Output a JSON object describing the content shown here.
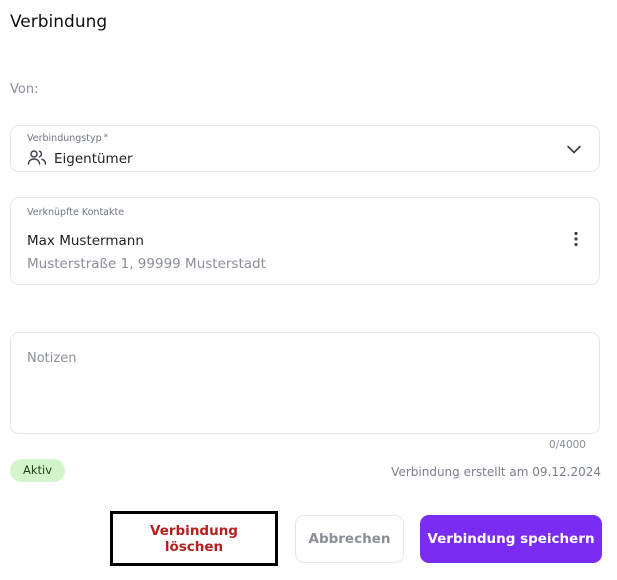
{
  "dialog": {
    "title": "Verbindung",
    "from_label": "Von:"
  },
  "connection_type": {
    "label": "Verbindungstyp",
    "required_mark": "*",
    "value": "Eigentümer",
    "icon": "people-icon",
    "dropdown_icon": "chevron-down-icon"
  },
  "linked_contacts": {
    "label": "Verknüpfte Kontakte",
    "contact": {
      "name": "Max Mustermann",
      "address": "Musterstraße 1, 99999 Musterstadt"
    },
    "menu_icon": "more-vertical-icon"
  },
  "notes": {
    "placeholder": "Notizen",
    "value": "",
    "counter": "0/4000"
  },
  "status": {
    "badge": "Aktiv",
    "badge_color": "#d3f5cc",
    "created_text": "Verbindung erstellt am 09.12.2024"
  },
  "actions": {
    "delete_label": "Verbindung löschen",
    "cancel_label": "Abbrechen",
    "save_label": "Verbindung speichern",
    "delete_color": "#b71f1f",
    "save_color": "#7b2cf2"
  }
}
